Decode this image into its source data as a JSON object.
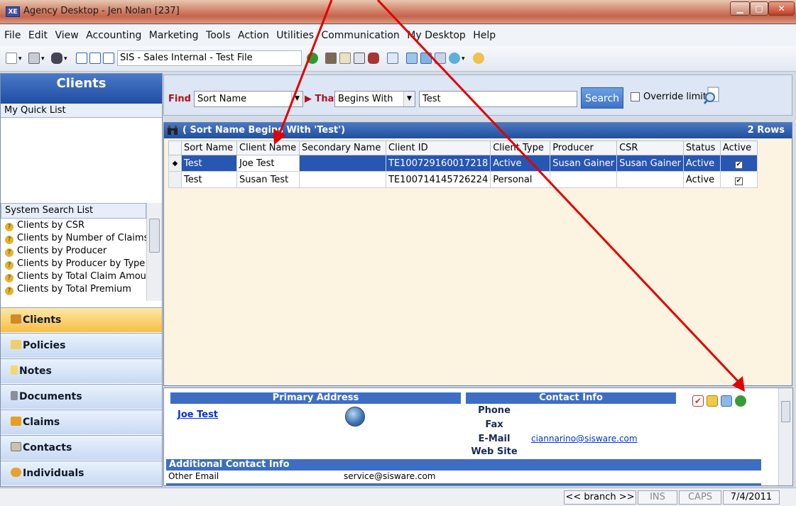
{
  "window": {
    "title": "Agency Desktop - Jen Nolan [237]",
    "logo": "XE"
  },
  "menu": [
    "File",
    "Edit",
    "View",
    "Accounting",
    "Marketing",
    "Tools",
    "Action",
    "Utilities",
    "Communication",
    "My Desktop",
    "Help"
  ],
  "toolbar": {
    "file_combo": "SIS - Sales Internal - Test File"
  },
  "sidebar": {
    "title": "Clients",
    "quick_list": "My Quick List",
    "system_search_list": "System Search List",
    "search_items": [
      "Clients by CSR",
      "Clients by Number of Claims",
      "Clients by Producer",
      "Clients by Producer by Type",
      "Clients by Total Claim Amount",
      "Clients by Total Premium"
    ],
    "nav": [
      "Clients",
      "Policies",
      "Notes",
      "Documents",
      "Claims",
      "Contacts",
      "Individuals"
    ]
  },
  "find": {
    "find_label": "Find",
    "field": "Sort Name",
    "that_label": "That",
    "operator": "Begins With",
    "value": "Test",
    "search_label": "Search",
    "override_label": "Override limit"
  },
  "results": {
    "title": "( Sort Name Begins With 'Test')",
    "row_count": "2 Rows",
    "columns": [
      "Sort Name",
      "Client Name",
      "Secondary Name",
      "Client ID",
      "Client Type",
      "Producer",
      "CSR",
      "Status",
      "Active"
    ],
    "rows": [
      {
        "marker": "◆",
        "sort_name": "Test",
        "client_name": "Joe Test",
        "secondary": "",
        "client_id": "TE100729160017218",
        "type": "Active",
        "producer": "Susan Gainer",
        "csr": "Susan Gainer",
        "status": "Active",
        "active": "✔"
      },
      {
        "marker": "",
        "sort_name": "Test",
        "client_name": "Susan Test",
        "secondary": "",
        "client_id": "TE100714145726224",
        "type": "Personal",
        "producer": "",
        "csr": "",
        "status": "Active",
        "active": "✔"
      }
    ]
  },
  "detail": {
    "primary_address": "Primary Address",
    "contact_info": "Contact Info",
    "client_link": "Joe Test",
    "phone_label": "Phone",
    "fax_label": "Fax",
    "email_label": "E-Mail",
    "email_value": "ciannarino@sisware.com",
    "website_label": "Web Site",
    "additional": "Additional Contact Info",
    "other_email_label": "Other Email",
    "other_email_value": "service@sisware.com"
  },
  "status": {
    "branch": "<< branch >>",
    "ins": "INS",
    "caps": "CAPS",
    "date": "7/4/2011"
  },
  "colors": {
    "accent": "#2756b3",
    "arrow": "#e00000",
    "active_nav": "#f7bf45"
  }
}
